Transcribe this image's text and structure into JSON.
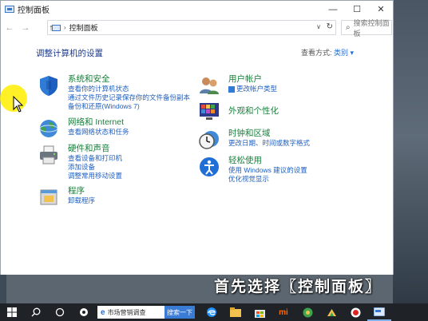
{
  "window": {
    "title": "控制面板",
    "controls": {
      "minimize": "—",
      "maximize": "☐",
      "close": "✕"
    }
  },
  "navigation": {
    "back": "←",
    "forward": "→",
    "up": "↑",
    "address_path": "控制面板",
    "refresh": "↻",
    "search_placeholder": "搜索控制面板"
  },
  "content": {
    "heading": "调整计算机的设置",
    "view_by_label": "查看方式:",
    "view_by_value": "类别 ▾"
  },
  "categories": {
    "system_security": {
      "title": "系统和安全",
      "links": [
        "查看你的计算机状态",
        "通过文件历史记录保存你的文件备份副本",
        "备份和还原(Windows 7)"
      ]
    },
    "network": {
      "title": "网络和 Internet",
      "links": [
        "查看网络状态和任务"
      ]
    },
    "hardware": {
      "title": "硬件和声音",
      "links": [
        "查看设备和打印机",
        "添加设备",
        "调整常用移动设置"
      ]
    },
    "programs": {
      "title": "程序",
      "links": [
        "卸载程序"
      ]
    },
    "user_accounts": {
      "title": "用户帐户",
      "links": [
        "更改帐户类型"
      ]
    },
    "appearance": {
      "title": "外观和个性化",
      "links": []
    },
    "clock_region": {
      "title": "时钟和区域",
      "links": [
        "更改日期、时间或数字格式"
      ]
    },
    "ease_of_access": {
      "title": "轻松使用",
      "links": [
        "使用 Windows 建议的设置",
        "优化视觉显示"
      ]
    }
  },
  "caption": "首先选择〖控制面板〗",
  "taskbar": {
    "search_text": "市场营销调查",
    "search_button": "搜索一下",
    "icons": [
      "windows-start-icon",
      "search-icon",
      "task-view-icon",
      "app-icon",
      "edge-icon",
      "file-explorer-icon",
      "store-icon",
      "mi-icon",
      "green-app-icon",
      "mail-app-icon",
      "record-icon",
      "control-panel-icon"
    ]
  },
  "colors": {
    "category_title": "#17803b",
    "link": "#1f5fbf",
    "heading": "#1e3a8a",
    "cursor_highlight": "#ffee00",
    "taskbar": "#1f2227"
  }
}
